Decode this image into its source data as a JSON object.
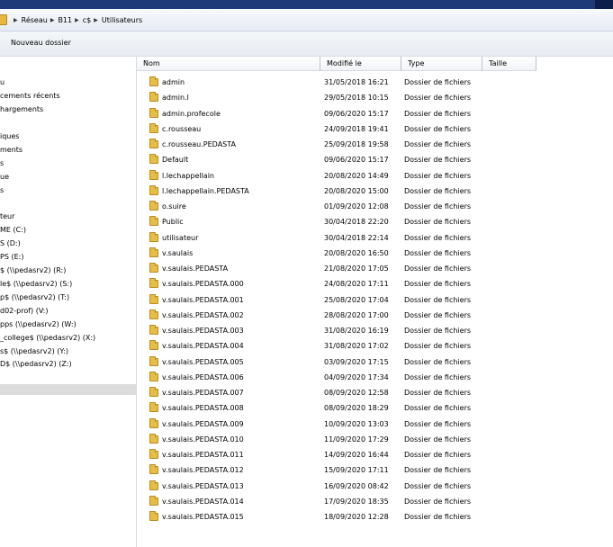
{
  "breadcrumb": [
    "Réseau",
    "B11",
    "c$",
    "Utilisateurs"
  ],
  "toolbar": {
    "new_folder": "Nouveau dossier"
  },
  "nav": [
    "u",
    "cements récents",
    "hargements",
    "",
    "iques",
    "ments",
    "s",
    "ue",
    "s",
    "",
    "teur",
    "ME (C:)",
    "S (D:)",
    "PS (E:)",
    "$ (\\\\pedasrv2) (R:)",
    "le$ (\\\\pedasrv2) (S:)",
    "p$ (\\\\pedasrv2) (T:)",
    "d02-prof) (V:)",
    "pps (\\\\pedasrv2) (W:)",
    "_college$ (\\\\pedasrv2) (X:)",
    "s$ (\\\\pedasrv2) (Y:)",
    "D$ (\\\\pedasrv2) (Z:)"
  ],
  "columns": {
    "name": "Nom",
    "modified": "Modifié le",
    "type": "Type",
    "size": "Taille"
  },
  "files": [
    {
      "name": "admin",
      "date": "31/05/2018 16:21",
      "type": "Dossier de fichiers"
    },
    {
      "name": "admin.l",
      "date": "29/05/2018 10:15",
      "type": "Dossier de fichiers"
    },
    {
      "name": "admin.profecole",
      "date": "09/06/2020 15:17",
      "type": "Dossier de fichiers"
    },
    {
      "name": "c.rousseau",
      "date": "24/09/2018 19:41",
      "type": "Dossier de fichiers"
    },
    {
      "name": "c.rousseau.PEDASTA",
      "date": "25/09/2018 19:58",
      "type": "Dossier de fichiers"
    },
    {
      "name": "Default",
      "date": "09/06/2020 15:17",
      "type": "Dossier de fichiers"
    },
    {
      "name": "l.lechappellain",
      "date": "20/08/2020 14:49",
      "type": "Dossier de fichiers"
    },
    {
      "name": "l.lechappellain.PEDASTA",
      "date": "20/08/2020 15:00",
      "type": "Dossier de fichiers"
    },
    {
      "name": "o.suire",
      "date": "01/09/2020 12:08",
      "type": "Dossier de fichiers"
    },
    {
      "name": "Public",
      "date": "30/04/2018 22:20",
      "type": "Dossier de fichiers"
    },
    {
      "name": "utilisateur",
      "date": "30/04/2018 22:14",
      "type": "Dossier de fichiers"
    },
    {
      "name": "v.saulais",
      "date": "20/08/2020 16:50",
      "type": "Dossier de fichiers"
    },
    {
      "name": "v.saulais.PEDASTA",
      "date": "21/08/2020 17:05",
      "type": "Dossier de fichiers"
    },
    {
      "name": "v.saulais.PEDASTA.000",
      "date": "24/08/2020 17:11",
      "type": "Dossier de fichiers"
    },
    {
      "name": "v.saulais.PEDASTA.001",
      "date": "25/08/2020 17:04",
      "type": "Dossier de fichiers"
    },
    {
      "name": "v.saulais.PEDASTA.002",
      "date": "28/08/2020 17:00",
      "type": "Dossier de fichiers"
    },
    {
      "name": "v.saulais.PEDASTA.003",
      "date": "31/08/2020 16:19",
      "type": "Dossier de fichiers"
    },
    {
      "name": "v.saulais.PEDASTA.004",
      "date": "31/08/2020 17:02",
      "type": "Dossier de fichiers"
    },
    {
      "name": "v.saulais.PEDASTA.005",
      "date": "03/09/2020 17:15",
      "type": "Dossier de fichiers"
    },
    {
      "name": "v.saulais.PEDASTA.006",
      "date": "04/09/2020 17:34",
      "type": "Dossier de fichiers"
    },
    {
      "name": "v.saulais.PEDASTA.007",
      "date": "08/09/2020 12:58",
      "type": "Dossier de fichiers"
    },
    {
      "name": "v.saulais.PEDASTA.008",
      "date": "08/09/2020 18:29",
      "type": "Dossier de fichiers"
    },
    {
      "name": "v.saulais.PEDASTA.009",
      "date": "10/09/2020 13:03",
      "type": "Dossier de fichiers"
    },
    {
      "name": "v.saulais.PEDASTA.010",
      "date": "11/09/2020 17:29",
      "type": "Dossier de fichiers"
    },
    {
      "name": "v.saulais.PEDASTA.011",
      "date": "14/09/2020 16:44",
      "type": "Dossier de fichiers"
    },
    {
      "name": "v.saulais.PEDASTA.012",
      "date": "15/09/2020 17:11",
      "type": "Dossier de fichiers"
    },
    {
      "name": "v.saulais.PEDASTA.013",
      "date": "16/09/2020 08:42",
      "type": "Dossier de fichiers"
    },
    {
      "name": "v.saulais.PEDASTA.014",
      "date": "17/09/2020 18:35",
      "type": "Dossier de fichiers"
    },
    {
      "name": "v.saulais.PEDASTA.015",
      "date": "18/09/2020 12:28",
      "type": "Dossier de fichiers"
    }
  ],
  "icons": {
    "folder": "folder-icon",
    "chevron": "chevron-right-icon",
    "sort": "sort-ascending-icon"
  }
}
